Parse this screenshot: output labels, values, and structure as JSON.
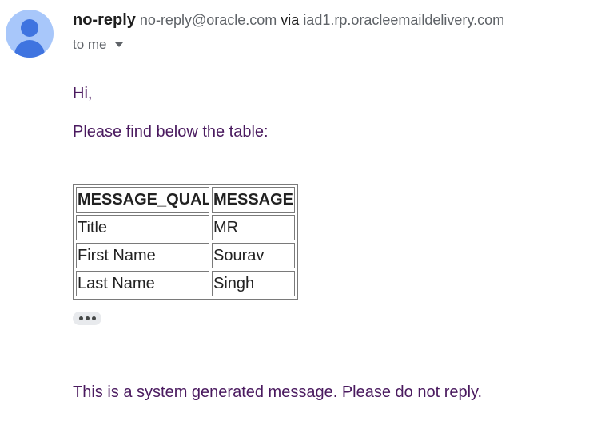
{
  "sender": {
    "name": "no-reply",
    "email": "no-reply@oracle.com",
    "via_label": "via",
    "via_domain": "iad1.rp.oracleemaildelivery.com"
  },
  "recipient": {
    "label": "to me"
  },
  "body": {
    "greeting": "Hi,",
    "intro": "Please find below the table:",
    "table": {
      "headers": [
        "MESSAGE_QUALIFIER",
        "MESSAGE"
      ],
      "rows": [
        [
          "Title",
          "MR"
        ],
        [
          "First Name",
          "Sourav"
        ],
        [
          "Last Name",
          "Singh"
        ]
      ]
    },
    "footer": "This is a system generated message. Please do not reply."
  },
  "icons": {
    "avatar": "person-avatar-icon",
    "recipient_dropdown": "caret-down-icon",
    "show_trimmed": "ellipsis-icon"
  },
  "colors": {
    "body_text": "#4a1a5f",
    "avatar_bg": "#a8c7fa",
    "avatar_fg": "#3f74e0"
  }
}
